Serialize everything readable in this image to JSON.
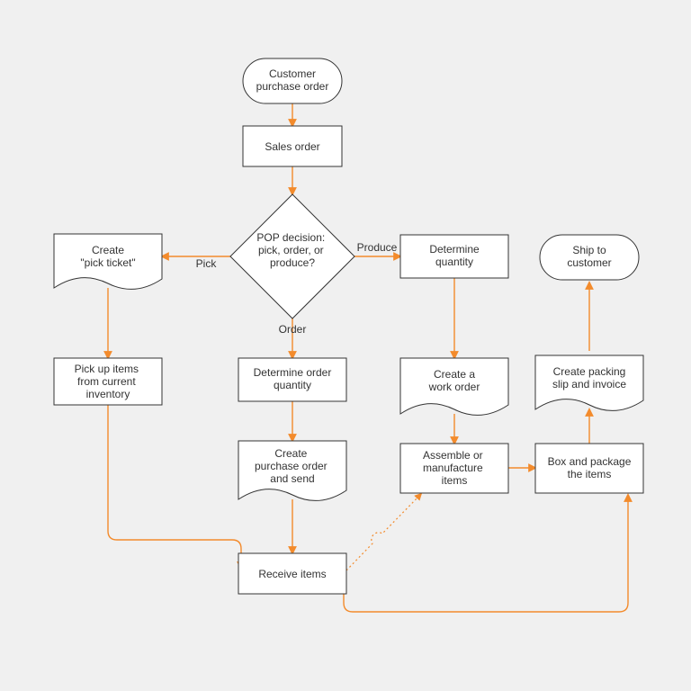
{
  "nodes": {
    "start": "Customer purchase order",
    "sales": "Sales order",
    "decision": "POP decision: pick, order, or produce?",
    "pickTicket": "Create \"pick ticket\"",
    "pickItems": "Pick up items from current inventory",
    "detOrderQty": "Determine order quantity",
    "createPO": "Create purchase order and send",
    "receive": "Receive items",
    "detQty": "Determine quantity",
    "workOrder": "Create a work order",
    "assemble": "Assemble or manufacture items",
    "box": "Box and package the items",
    "packSlip": "Create packing slip and invoice",
    "ship": "Ship to customer"
  },
  "edgeLabels": {
    "pick": "Pick",
    "order": "Order",
    "produce": "Produce"
  },
  "chart_data": {
    "type": "flowchart",
    "title": "",
    "nodes": [
      {
        "id": "start",
        "shape": "terminator",
        "label": "Customer purchase order"
      },
      {
        "id": "sales",
        "shape": "process",
        "label": "Sales order"
      },
      {
        "id": "decision",
        "shape": "decision",
        "label": "POP decision: pick, order, or produce?"
      },
      {
        "id": "pickTicket",
        "shape": "document",
        "label": "Create \"pick ticket\""
      },
      {
        "id": "pickItems",
        "shape": "process",
        "label": "Pick up items from current inventory"
      },
      {
        "id": "detOrderQty",
        "shape": "process",
        "label": "Determine order quantity"
      },
      {
        "id": "createPO",
        "shape": "document",
        "label": "Create purchase order and send"
      },
      {
        "id": "receive",
        "shape": "process",
        "label": "Receive items"
      },
      {
        "id": "detQty",
        "shape": "process",
        "label": "Determine quantity"
      },
      {
        "id": "workOrder",
        "shape": "document",
        "label": "Create a work order"
      },
      {
        "id": "assemble",
        "shape": "process",
        "label": "Assemble or manufacture items"
      },
      {
        "id": "box",
        "shape": "process",
        "label": "Box and package the items"
      },
      {
        "id": "packSlip",
        "shape": "document",
        "label": "Create packing slip and invoice"
      },
      {
        "id": "ship",
        "shape": "terminator",
        "label": "Ship to customer"
      }
    ],
    "edges": [
      {
        "from": "start",
        "to": "sales"
      },
      {
        "from": "sales",
        "to": "decision"
      },
      {
        "from": "decision",
        "to": "pickTicket",
        "label": "Pick"
      },
      {
        "from": "decision",
        "to": "detOrderQty",
        "label": "Order"
      },
      {
        "from": "decision",
        "to": "detQty",
        "label": "Produce"
      },
      {
        "from": "pickTicket",
        "to": "pickItems"
      },
      {
        "from": "detOrderQty",
        "to": "createPO"
      },
      {
        "from": "createPO",
        "to": "receive"
      },
      {
        "from": "detQty",
        "to": "workOrder"
      },
      {
        "from": "workOrder",
        "to": "assemble"
      },
      {
        "from": "assemble",
        "to": "box"
      },
      {
        "from": "pickItems",
        "to": "receive"
      },
      {
        "from": "receive",
        "to": "box"
      },
      {
        "from": "receive",
        "to": "assemble",
        "style": "dotted"
      },
      {
        "from": "box",
        "to": "packSlip"
      },
      {
        "from": "packSlip",
        "to": "ship"
      }
    ]
  }
}
